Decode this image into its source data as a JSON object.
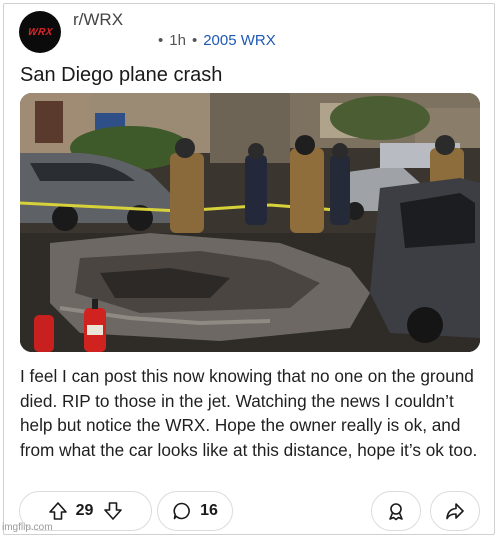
{
  "post": {
    "subreddit": "r/WRX",
    "avatar_text": "WRX",
    "time": "1h",
    "separator": "•",
    "flair": "2005 WRX",
    "title": "San Diego plane crash",
    "body": "I feel I can post this now knowing that no one on the ground died. RIP to those in the jet. Watching the news I couldn’t help but notice the WRX.  Hope the owner really is ok, and from what the car looks like at this distance, hope it’s ok too."
  },
  "actions": {
    "upvote_icon": "upvote-arrow-icon",
    "score": "29",
    "downvote_icon": "downvote-arrow-icon",
    "comment_icon": "speech-bubble-icon",
    "comments": "16",
    "award_icon": "award-icon",
    "share_icon": "share-arrow-icon"
  },
  "watermark": "imgflip.com",
  "colors": {
    "flair": "#1e58b4",
    "avatar_bg": "#0b0b0b",
    "avatar_text": "#e0262c"
  }
}
